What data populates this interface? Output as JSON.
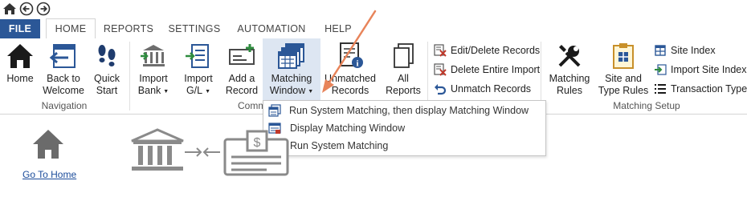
{
  "quick_access": {
    "icons": [
      "home-icon",
      "back-icon",
      "forward-icon"
    ]
  },
  "tabs": [
    "FILE",
    "HOME",
    "REPORTS",
    "SETTINGS",
    "AUTOMATION",
    "HELP"
  ],
  "active_tab": "HOME",
  "ribbon": {
    "navigation": {
      "group_label": "Navigation",
      "home": {
        "label": "Home",
        "icon": "home-icon"
      },
      "back_to_welcome": {
        "label1": "Back to",
        "label2": "Welcome",
        "icon": "back-to-welcome-icon"
      },
      "quick_start": {
        "label1": "Quick",
        "label2": "Start",
        "icon": "footsteps-icon"
      }
    },
    "common": {
      "group_label": "Comm",
      "import_bank": {
        "label1": "Import",
        "label2": "Bank",
        "icon": "import-bank-icon"
      },
      "import_gl": {
        "label1": "Import",
        "label2": "G/L",
        "icon": "import-gl-icon"
      },
      "add_record": {
        "label1": "Add a",
        "label2": "Record",
        "icon": "add-record-icon"
      },
      "matching_window": {
        "label1": "Matching",
        "label2": "Window",
        "icon": "matching-window-icon"
      },
      "unmatched_records": {
        "label1": "Unmatched",
        "label2": "Records",
        "icon": "unmatched-records-icon"
      },
      "all_reports": {
        "label1": "All",
        "label2": "Reports",
        "icon": "all-reports-icon"
      }
    },
    "records": {
      "edit_delete": "Edit/Delete Records",
      "delete_import": "Delete Entire Import",
      "unmatch": "Unmatch Records"
    },
    "matching_setup": {
      "group_label": "Matching Setup",
      "matching_rules": {
        "label1": "Matching",
        "label2": "Rules",
        "icon": "tools-icon"
      },
      "site_type_rules": {
        "label1": "Site and",
        "label2": "Type Rules",
        "icon": "clipboard-icon"
      },
      "site_index": "Site Index",
      "import_site_index": "Import Site Index",
      "transaction_types": "Transaction Types"
    }
  },
  "dropdown": {
    "items": [
      "Run System Matching, then display Matching Window",
      "Display Matching Window",
      "Run System Matching"
    ]
  },
  "content": {
    "go_to_home": "Go To Home"
  },
  "colors": {
    "file_tab": "#2b5797",
    "highlight": "#dde6f2",
    "annotation_arrow": "#e8845a",
    "link": "#1a4b9a"
  }
}
